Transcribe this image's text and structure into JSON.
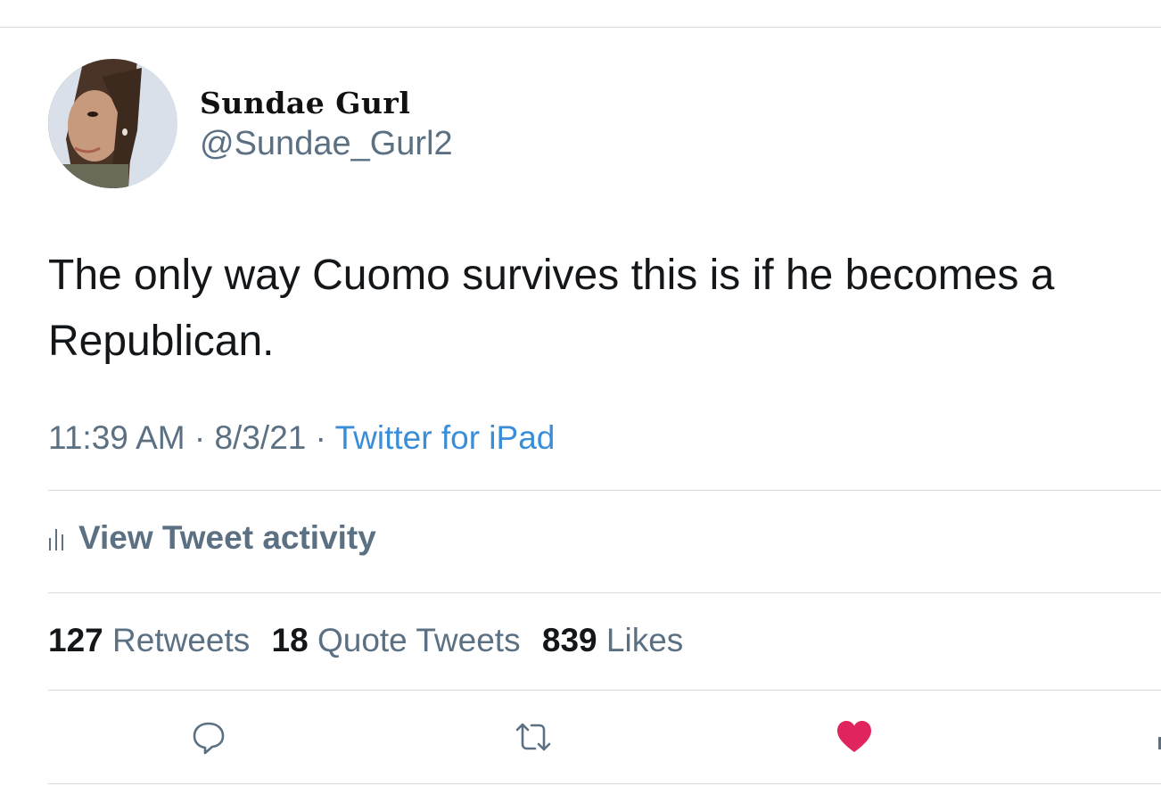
{
  "author": {
    "display_name": "Sundae Gurl",
    "handle": "@Sundae_Gurl2"
  },
  "tweet": {
    "text": "The only way Cuomo survives this is if he becomes a Republican.",
    "time": "11:39 AM",
    "date": "8/3/21",
    "separator": "·",
    "source": "Twitter for iPad"
  },
  "activity": {
    "label": "View Tweet activity"
  },
  "stats": {
    "retweets_count": "127",
    "retweets_label": "Retweets",
    "quotes_count": "18",
    "quotes_label": "Quote Tweets",
    "likes_count": "839",
    "likes_label": "Likes"
  },
  "actions": {
    "reply_icon": "reply-icon",
    "retweet_icon": "retweet-icon",
    "like_icon": "heart-icon-filled",
    "like_color": "#e0245e",
    "icon_color": "#5b7083"
  }
}
